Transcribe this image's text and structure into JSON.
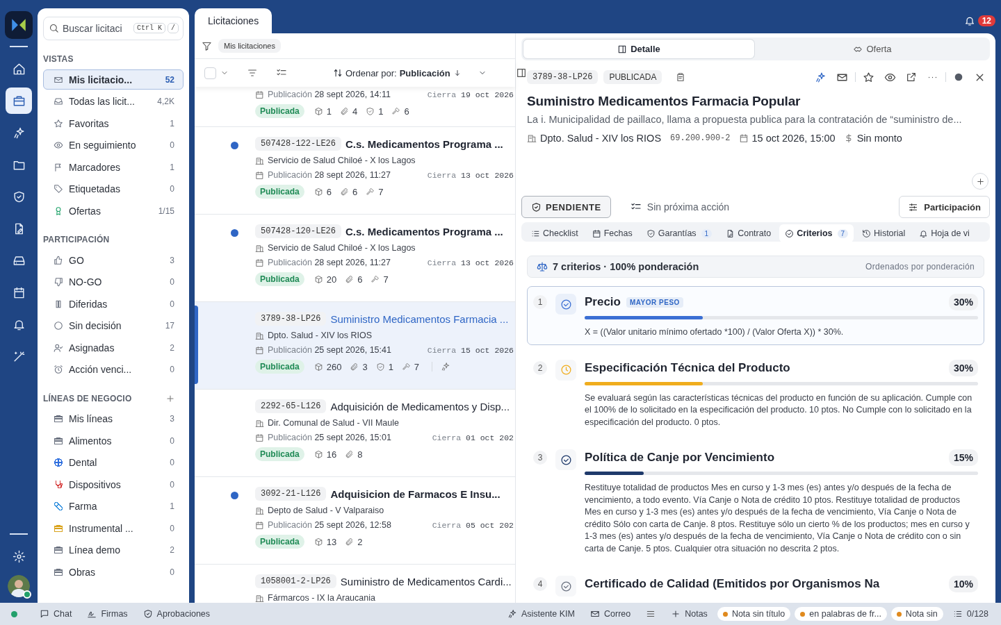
{
  "rail": {
    "items": [
      {
        "selected": false
      },
      {
        "selected": true
      },
      {
        "selected": false
      },
      {
        "selected": false
      },
      {
        "selected": false
      },
      {
        "selected": false
      },
      {
        "selected": false
      },
      {
        "selected": false
      },
      {
        "selected": false
      },
      {
        "selected": false
      }
    ],
    "user_online": true
  },
  "sidebar": {
    "search": {
      "placeholder": "Buscar licitaci",
      "keys": [
        "Ctrl K",
        "/"
      ]
    },
    "sections": [
      {
        "title": "VISTAS",
        "items": [
          {
            "label": "Mis licitacio...",
            "count": "52",
            "selected": true
          },
          {
            "label": "Todas las licit...",
            "count": "4,2K",
            "selected": false
          },
          {
            "label": "Favoritas",
            "count": "1",
            "selected": false
          },
          {
            "label": "En seguimiento",
            "count": "0",
            "selected": false
          },
          {
            "label": "Marcadores",
            "count": "1",
            "selected": false
          },
          {
            "label": "Etiquetadas",
            "count": "0",
            "selected": false
          },
          {
            "label": "Ofertas",
            "count": "1/15",
            "selected": false
          }
        ]
      },
      {
        "title": "PARTICIPACIÓN",
        "items": [
          {
            "label": "GO",
            "count": "3",
            "selected": false
          },
          {
            "label": "NO-GO",
            "count": "0",
            "selected": false
          },
          {
            "label": "Diferidas",
            "count": "0",
            "selected": false
          },
          {
            "label": "Sin decisión",
            "count": "17",
            "selected": false
          },
          {
            "label": "Asignadas",
            "count": "2",
            "selected": false
          },
          {
            "label": "Acción venci...",
            "count": "0",
            "selected": false
          }
        ]
      },
      {
        "title": "LÍNEAS DE NEGOCIO",
        "addable": true,
        "items": [
          {
            "label": "Mis líneas",
            "count": "3",
            "selected": false,
            "color": "#6b7280"
          },
          {
            "label": "Alimentos",
            "count": "0",
            "selected": false,
            "color": "#6b7280"
          },
          {
            "label": "Dental",
            "count": "0",
            "selected": false,
            "color": "#2f6fde"
          },
          {
            "label": "Dispositivos",
            "count": "0",
            "selected": false,
            "color": "#d63b3b"
          },
          {
            "label": "Farma",
            "count": "1",
            "selected": false,
            "color": "#2f8fde"
          },
          {
            "label": "Instrumental ...",
            "count": "0",
            "selected": false,
            "color": "#d9a21b"
          },
          {
            "label": "Línea demo",
            "count": "2",
            "selected": false,
            "color": "#6b7280"
          },
          {
            "label": "Obras",
            "count": "0",
            "selected": false,
            "color": "#6b7280"
          }
        ]
      }
    ]
  },
  "main": {
    "tab": "Licitaciones",
    "notifications": "12",
    "filter_chip": "Mis licitaciones",
    "select_all": {
      "checked": false
    },
    "sort": {
      "label": "Ordenar por:",
      "value": "Publicación"
    },
    "rows": [
      {
        "published_label": "Publicación",
        "published": "28 sept 2026, 14:11",
        "closes_label": "Cierra",
        "closes": "19 oct 2026",
        "status": "Publicada",
        "selected": false,
        "stats": [
          {
            "kind": "items",
            "value": "1"
          },
          {
            "kind": "attachments",
            "value": "4"
          },
          {
            "kind": "guarantees",
            "value": "1"
          },
          {
            "kind": "actions",
            "value": "6"
          }
        ]
      },
      {
        "code": "507428-122-LE26",
        "title": "C.s. Medicamentos Programa ...",
        "org": "Servicio de Salud Chiloé - X los Lagos",
        "published_label": "Publicación",
        "published": "28 sept 2026, 11:27",
        "closes_label": "Cierra",
        "closes": "13 oct 2026",
        "status": "Publicada",
        "unread": true,
        "selected": false,
        "ai": false,
        "stats": [
          {
            "kind": "items",
            "value": "6"
          },
          {
            "kind": "attachments",
            "value": "6"
          },
          {
            "kind": "actions",
            "value": "7"
          }
        ]
      },
      {
        "code": "507428-120-LE26",
        "title": "C.s. Medicamentos Programa ...",
        "org": "Servicio de Salud Chiloé - X los Lagos",
        "published_label": "Publicación",
        "published": "28 sept 2026, 11:27",
        "closes_label": "Cierra",
        "closes": "13 oct 2026",
        "status": "Publicada",
        "unread": true,
        "selected": false,
        "ai": false,
        "stats": [
          {
            "kind": "items",
            "value": "20"
          },
          {
            "kind": "attachments",
            "value": "6"
          },
          {
            "kind": "actions",
            "value": "7"
          }
        ]
      },
      {
        "code": "3789-38-LP26",
        "title": "Suministro Medicamentos Farmacia ...",
        "org": "Dpto. Salud - XIV los RIOS",
        "published_label": "Publicación",
        "published": "25 sept 2026, 15:41",
        "closes_label": "Cierra",
        "closes": "15 oct 2026",
        "status": "Publicada",
        "unread": false,
        "selected": true,
        "ai": true,
        "stats": [
          {
            "kind": "items",
            "value": "260"
          },
          {
            "kind": "attachments",
            "value": "3"
          },
          {
            "kind": "guarantees",
            "value": "1"
          },
          {
            "kind": "actions",
            "value": "7"
          }
        ]
      },
      {
        "code": "2292-65-L126",
        "title": "Adquisición de Medicamentos y Disp...",
        "org": "Dir. Comunal de Salud - VII Maule",
        "published_label": "Publicación",
        "published": "25 sept 2026, 15:01",
        "closes_label": "Cierra",
        "closes": "01 oct 202",
        "status": "Publicada",
        "unread": false,
        "selected": false,
        "ai": false,
        "stats": [
          {
            "kind": "items",
            "value": "16"
          },
          {
            "kind": "attachments",
            "value": "8"
          }
        ]
      },
      {
        "code": "3092-21-L126",
        "title": "Adquisicion de Farmacos E Insu...",
        "org": "Depto de Salud - V Valparaiso",
        "published_label": "Publicación",
        "published": "25 sept 2026, 12:58",
        "closes_label": "Cierra",
        "closes": "05 oct 202",
        "status": "Publicada",
        "unread": true,
        "selected": false,
        "ai": false,
        "stats": [
          {
            "kind": "items",
            "value": "13"
          },
          {
            "kind": "attachments",
            "value": "2"
          }
        ]
      },
      {
        "code": "1058001-2-LP26",
        "title": "Suministro de Medicamentos Cardi...",
        "org": "Fármarcos - IX la Araucania",
        "unread": false,
        "selected": false
      }
    ]
  },
  "detail": {
    "tabs": [
      {
        "label": "Detalle",
        "selected": true
      },
      {
        "label": "Oferta",
        "selected": false
      }
    ],
    "code": "3789-38-LP26",
    "status": "PUBLICADA",
    "title": "Suministro Medicamentos Farmacia Popular",
    "description": "La i. Municipalidad de paillaco, llama a propuesta publica para la contratación de “suministro de...",
    "org": "Dpto. Salud - XIV los RIOS",
    "rut": "69.200.900-2",
    "deadline": "15 oct 2026, 15:00",
    "amount": "Sin monto",
    "decision": "PENDIENTE",
    "next_action": "Sin próxima acción",
    "participation": "Participación",
    "subtabs": [
      {
        "label": "Checklist",
        "selected": false
      },
      {
        "label": "Fechas",
        "selected": false
      },
      {
        "label": "Garantías",
        "count": "1",
        "selected": false
      },
      {
        "label": "Contrato",
        "selected": false
      },
      {
        "label": "Criterios",
        "count": "7",
        "selected": true
      },
      {
        "label": "Historial",
        "selected": false
      },
      {
        "label": "Hoja de vi",
        "selected": false
      }
    ],
    "summary": "7 criterios · 100% ponderación",
    "summary_note": "Ordenados por ponderación",
    "criteria": [
      {
        "rank": "1",
        "name": "Precio",
        "badge": "MAYOR PESO",
        "weight": "30%",
        "level": 0.3,
        "color": "#3b6fd4",
        "selected": true,
        "description": "X = ((Valor unitario mínimo ofertado *100) / (Valor Oferta X)) * 30%."
      },
      {
        "rank": "2",
        "name": "Especificación Técnica del Producto",
        "weight": "30%",
        "level": 0.3,
        "color": "#f0ad1e",
        "selected": false,
        "description": "Se evaluará según las características técnicas del producto en función de su aplicación. Cumple con el 100% de lo solicitado en la especificación del producto. 10 ptos. No Cumple con lo solicitado en la especificación del producto. 0 ptos."
      },
      {
        "rank": "3",
        "name": "Política de Canje por Vencimiento",
        "weight": "15%",
        "level": 0.15,
        "color": "#1f3a6b",
        "selected": false,
        "description": "Restituye totalidad de productos Mes en curso y 1-3 mes (es) antes y/o después de la fecha de vencimiento, a todo evento. Vía Canje o Nota de crédito 10 ptos. Restituye totalidad de productos Mes en curso y 1-3 mes (es) antes y/o después de la fecha de vencimiento, Vía Canje o Nota de crédito Sólo con carta de Canje. 8 ptos. Restituye sólo un cierto % de los productos; mes en curso y 1-3 mes (es) antes y/o después de la fecha de vencimiento, Vía Canje o Nota de crédito con o sin carta de Canje. 5 ptos. Cualquier otra situación no descrita 2 ptos."
      },
      {
        "rank": "4",
        "name": "Certificado de Calidad (Emitidos por Organismos Na",
        "weight": "10%",
        "selected": false,
        "color": "#6b7280"
      }
    ]
  },
  "bottom_bar": {
    "left": [
      "Chat",
      "Firmas",
      "Aprobaciones"
    ],
    "assistant": "Asistente KIM",
    "mail": "Correo",
    "notes": "Notas",
    "note_chips": [
      {
        "label": "Nota sin título",
        "color": "#e08a1e"
      },
      {
        "label": "en palabras de fr...",
        "color": "#e08a1e"
      },
      {
        "label": "Nota sin",
        "color": "#e08a1e"
      }
    ],
    "counter": "0/128"
  }
}
